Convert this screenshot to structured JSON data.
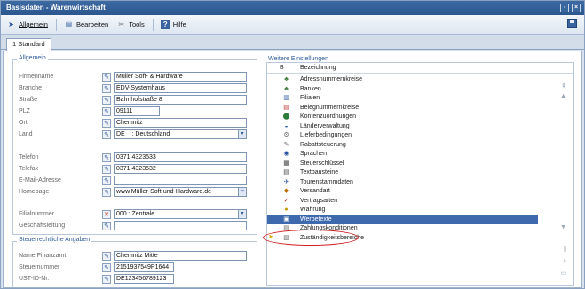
{
  "window": {
    "title": "Basisdaten - Warenwirtschaft"
  },
  "toolbar": {
    "items": [
      {
        "label": "Allgemein",
        "icon": "arrow-icon"
      },
      {
        "label": "Bearbeiten",
        "icon": "edit-icon"
      },
      {
        "label": "Tools",
        "icon": "tools-icon"
      },
      {
        "label": "Hilfe",
        "icon": "help-icon"
      }
    ]
  },
  "tabs": [
    {
      "label": "1 Standard"
    }
  ],
  "allgemein": {
    "title": "Allgemein",
    "fields": [
      {
        "label": "Firmenname",
        "value": "Müller Soft- & Hardware"
      },
      {
        "label": "Branche",
        "value": "EDV-Systemhaus"
      },
      {
        "label": "Straße",
        "value": "Bahnhofstraße 8"
      },
      {
        "label": "PLZ",
        "value": "09111"
      },
      {
        "label": "Ort",
        "value": "Chemnitz"
      },
      {
        "label": "Land",
        "value": "DE    : Deutschland"
      },
      {
        "label": "Telefon",
        "value": "0371 4323533"
      },
      {
        "label": "Telefax",
        "value": "0371 4323532"
      },
      {
        "label": "E-Mail-Adresse",
        "value": ""
      },
      {
        "label": "Homepage",
        "value": "www.Müller-Soft-und-Hardware.de"
      },
      {
        "label": "Filialnummer",
        "value": "000 : Zentrale"
      },
      {
        "label": "Geschäftsleitung",
        "value": ""
      }
    ]
  },
  "steuer": {
    "title": "Steuerrechtliche Angaben",
    "fields": [
      {
        "label": "Name Finanzamt",
        "value": "Chemnitz Mitte"
      },
      {
        "label": "Steuernummer",
        "value": "2151937549P1644"
      },
      {
        "label": "UST-ID-Nr.",
        "value": "DE123456789123"
      }
    ]
  },
  "weitere": {
    "title": "Weitere Einstellungen",
    "col_b": "B",
    "col_name": "Bezeichnung",
    "items": [
      "Adressnummernkreise",
      "Banken",
      "Filialen",
      "Belegnummernkreise",
      "Kontenzuordnungen",
      "Länderverwaltung",
      "Lieferbedingungen",
      "Rabattsteuerung",
      "Sprachen",
      "Steuerschlüssel",
      "Textbausteine",
      "Tourenstammdaten",
      "Versandart",
      "Vertragsarten",
      "Währung",
      "Werbetexte",
      "Zahlungskonditionen",
      "Zuständigkeitsbereiche"
    ],
    "selected_index": 15
  }
}
